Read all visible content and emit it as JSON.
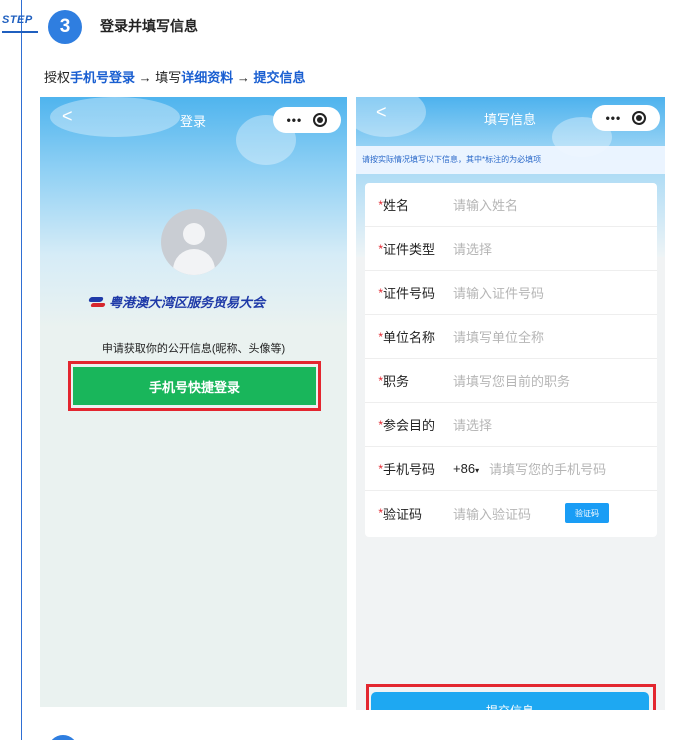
{
  "header": {
    "step_label": "STEP",
    "step_number": "3",
    "title": "登录并填写信息"
  },
  "flow": {
    "part1": "授权",
    "hl1": "手机号登录",
    "arrow1": " → 填写",
    "hl2": "详细资料",
    "arrow2": " → ",
    "hl3": "提交信息"
  },
  "login_screen": {
    "back": "<",
    "title": "登录",
    "capsule_dots": "•••",
    "org_name": "粤港澳大湾区服务贸易大会",
    "permission_text": "申请获取你的公开信息(昵称、头像等)",
    "login_button": "手机号快捷登录"
  },
  "form_screen": {
    "back": "<",
    "title": "填写信息",
    "capsule_dots": "•••",
    "notice": "请按实际情况填写以下信息，其中*标注的为必填项",
    "fields": [
      {
        "label": "姓名",
        "placeholder": "请输入姓名"
      },
      {
        "label": "证件类型",
        "placeholder": "请选择"
      },
      {
        "label": "证件号码",
        "placeholder": "请输入证件号码"
      },
      {
        "label": "单位名称",
        "placeholder": "请填写单位全称"
      },
      {
        "label": "职务",
        "placeholder": "请填写您目前的职务"
      },
      {
        "label": "参会目的",
        "placeholder": "请选择"
      },
      {
        "label": "手机号码",
        "prefix": "+86",
        "placeholder": "请填写您的手机号码"
      },
      {
        "label": "验证码",
        "placeholder": "请输入验证码"
      }
    ],
    "required_mark": "*",
    "sms_button": "验证码",
    "submit_button": "提交信息"
  },
  "colors": {
    "accent": "#2f7ee0",
    "highlight_text": "#1a5fd1",
    "login_green": "#19b65b",
    "submit_blue": "#1ea8f2",
    "annotation_red": "#e3262f"
  }
}
